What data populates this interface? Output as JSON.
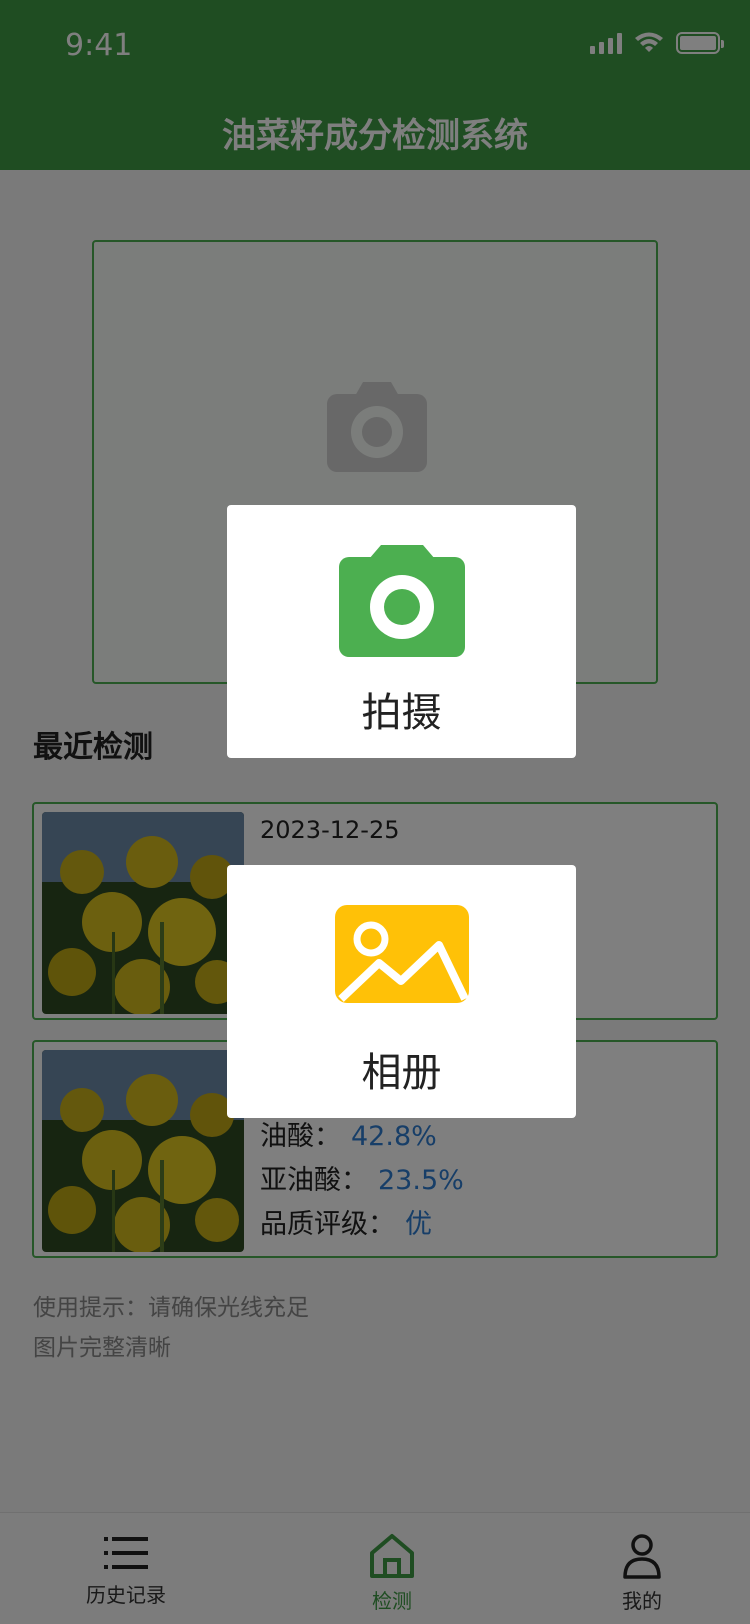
{
  "status_bar": {
    "time": "9:41"
  },
  "header": {
    "title": "油菜籽成分检测系统"
  },
  "main": {
    "recent_title": "最近检测",
    "records": [
      {
        "date": "2023-12-25",
        "oleic_label": "油酸：",
        "oleic": "",
        "linoleic_label": "亚油酸：",
        "linoleic": "",
        "grade_label": "品质评级：",
        "grade": ""
      },
      {
        "date": "",
        "oleic_label": "油酸：",
        "oleic": "42.8%",
        "linoleic_label": "亚油酸：",
        "linoleic": "23.5%",
        "grade_label": "品质评级：",
        "grade": "优"
      }
    ],
    "tips": [
      "使用提示：请确保光线充足",
      "图片完整清晰"
    ]
  },
  "tabbar": {
    "items": [
      {
        "label": "历史记录",
        "icon": "list-icon"
      },
      {
        "label": "检测",
        "icon": "home-icon",
        "active": true
      },
      {
        "label": "我的",
        "icon": "user-icon"
      }
    ]
  },
  "modal": {
    "camera_label": "拍摄",
    "album_label": "相册"
  },
  "colors": {
    "brand": "#3e9a45",
    "accent_blue": "#2e7dd1",
    "album_yellow": "#ffc107",
    "camera_green": "#4caf50"
  }
}
